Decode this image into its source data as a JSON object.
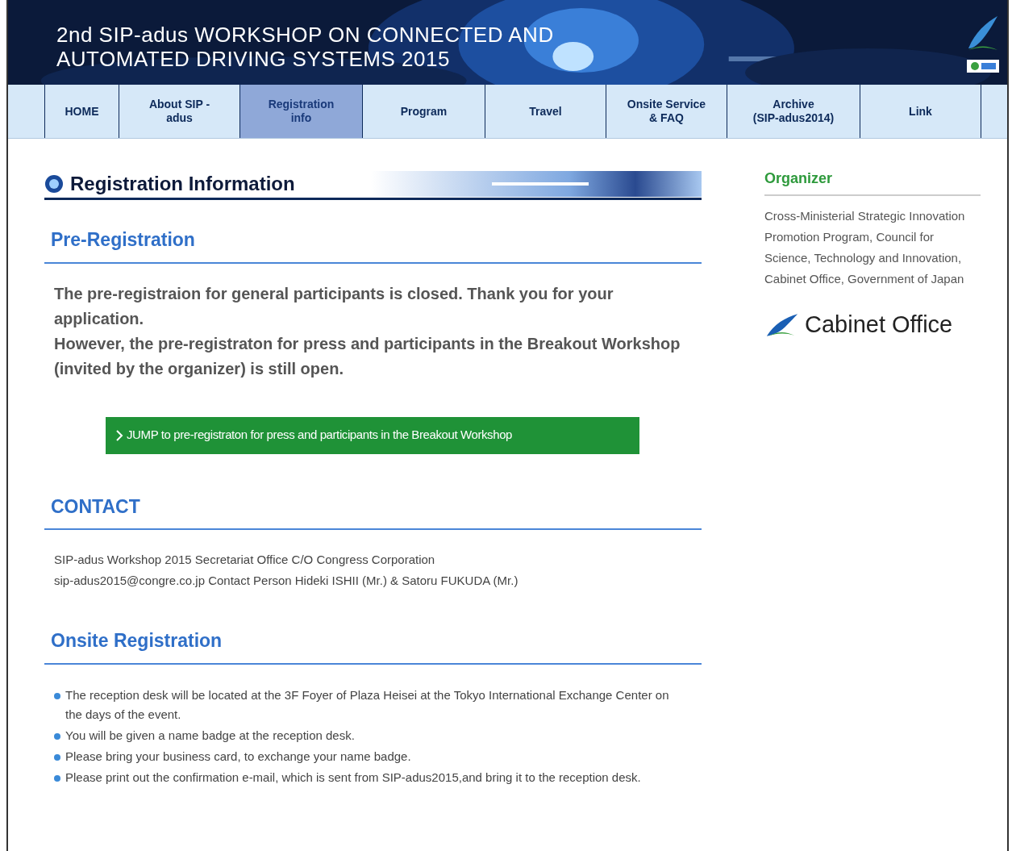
{
  "banner": {
    "title_lines": [
      "2nd SIP-adus WORKSHOP ON CONNECTED AND",
      "AUTOMATED DRIVING SYSTEMS 2015"
    ]
  },
  "nav": [
    {
      "label": "HOME",
      "selected": false
    },
    {
      "label": "About SIP -\nadus",
      "selected": false
    },
    {
      "label": "Registration\ninfo",
      "selected": true
    },
    {
      "label": "Program",
      "selected": false
    },
    {
      "label": "Travel",
      "selected": false
    },
    {
      "label": "Onsite Service\n& FAQ",
      "selected": false
    },
    {
      "label": "Archive\n(SIP-adus2014)",
      "selected": false
    },
    {
      "label": "Link",
      "selected": false
    }
  ],
  "page_title": "Registration Information",
  "pre_registration": {
    "heading": "Pre-Registration",
    "paragraphs": [
      "The pre-registraion for general participants is closed. Thank you for your application.",
      "However, the pre-registraton for press and participants in the Breakout Workshop (invited by the organizer) is still open."
    ],
    "button": "JUMP to pre-registraton for press and participants in the Breakout Workshop"
  },
  "contact": {
    "heading": "CONTACT",
    "lines": [
      "SIP-adus Workshop 2015 Secretariat Office C/O Congress Corporation",
      "sip-adus2015@congre.co.jp Contact Person Hideki ISHII (Mr.) & Satoru FUKUDA (Mr.)"
    ]
  },
  "onsite": {
    "heading": "Onsite Registration",
    "items": [
      "The reception desk will be located at the 3F Foyer of Plaza Heisei at the Tokyo International Exchange Center on the days of the event.",
      "You will be given a name badge at the reception desk.",
      "Please bring your business card, to exchange your name badge.",
      "Please print out the confirmation e-mail, which is sent from SIP-adus2015,and bring it to the reception desk."
    ]
  },
  "sidebar": {
    "heading": "Organizer",
    "text": "Cross-Ministerial Strategic Innovation Promotion Program, Council for Science, Technology and Innovation, Cabinet Office, Government of Japan",
    "logo_text": "Cabinet Office"
  }
}
